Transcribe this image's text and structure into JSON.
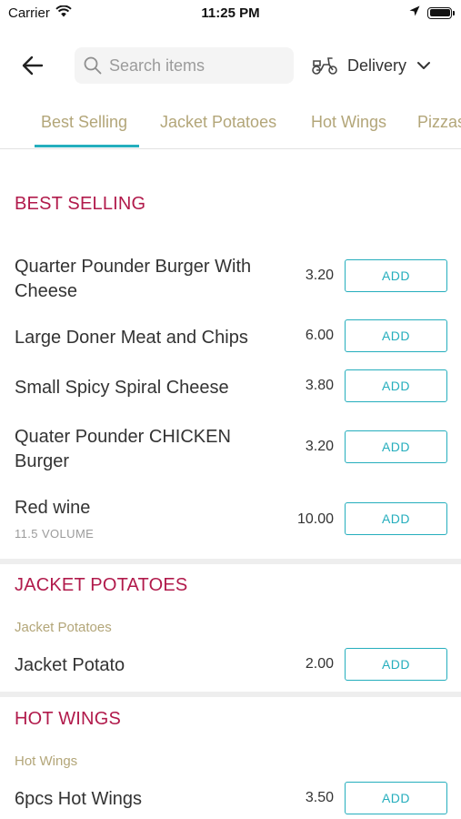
{
  "status_bar": {
    "carrier": "Carrier",
    "time": "11:25 PM"
  },
  "header": {
    "search_placeholder": "Search items",
    "delivery_label": "Delivery"
  },
  "tabs": [
    {
      "label": "Best Selling",
      "active": true
    },
    {
      "label": "Jacket Potatoes",
      "active": false
    },
    {
      "label": "Hot Wings",
      "active": false
    },
    {
      "label": "Pizzas",
      "active": false
    }
  ],
  "sections": [
    {
      "title": "BEST SELLING",
      "subtitle": "",
      "items": [
        {
          "name": "Quarter Pounder Burger With Cheese",
          "price": "3.20",
          "button": "ADD"
        },
        {
          "name": "Large Doner Meat and Chips",
          "price": "6.00",
          "button": "ADD"
        },
        {
          "name": "Small Spicy Spiral Cheese",
          "price": "3.80",
          "button": "ADD"
        },
        {
          "name": "Quater Pounder CHICKEN Burger",
          "price": "3.20",
          "button": "ADD"
        },
        {
          "name": "Red wine",
          "detail": "11.5 VOLUME",
          "price": "10.00",
          "button": "ADD"
        }
      ]
    },
    {
      "title": "JACKET POTATOES",
      "subtitle": "Jacket Potatoes",
      "items": [
        {
          "name": "Jacket Potato",
          "price": "2.00",
          "button": "ADD"
        }
      ]
    },
    {
      "title": "HOT WINGS",
      "subtitle": "Hot Wings",
      "items": [
        {
          "name": "6pcs Hot Wings",
          "price": "3.50",
          "button": "ADD"
        }
      ]
    }
  ],
  "colors": {
    "accent": "#25aebd",
    "section_title": "#b11a4b",
    "tab_text": "#b3a679",
    "subtitle": "#b3a679"
  },
  "icons": [
    "wifi-icon",
    "location-arrow-icon",
    "battery-icon",
    "back-arrow-icon",
    "search-icon",
    "scooter-icon",
    "chevron-down-icon"
  ]
}
